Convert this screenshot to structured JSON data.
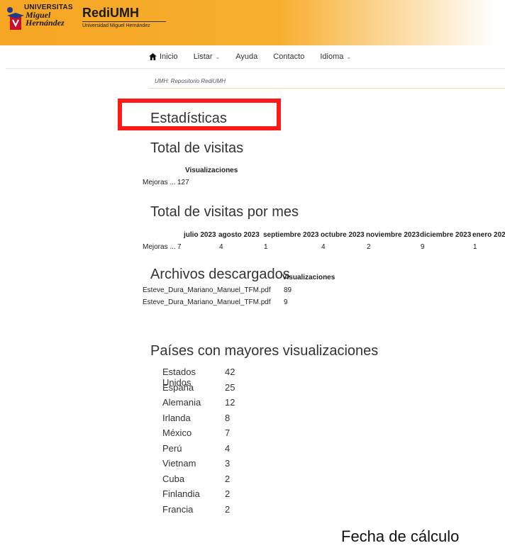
{
  "header": {
    "umh_logo_line1": "UNIVERSITAS",
    "umh_logo_line2": "Miguel Hernández",
    "repo_title": "RediUMH",
    "repo_subtitle": "Universidad Miguel Hernández"
  },
  "nav": {
    "home": "Inicio",
    "listar": "Listar",
    "ayuda": "Ayuda",
    "contacto": "Contacto",
    "idioma": "Idioma",
    "home_icon": "home-icon",
    "caret": "⌄"
  },
  "breadcrumb": "UMH: Repositorio RediUMH",
  "page_title": "Estadísticas",
  "total_visits": {
    "heading": "Total de visitas",
    "column": "Visualizaciones",
    "row_label": "Mejoras ...",
    "row_value": "127"
  },
  "monthly": {
    "heading": "Total de visitas por mes",
    "months": [
      "julio 2023",
      "agosto 2023",
      "septiembre 2023",
      "octubre 2023",
      "noviembre 2023",
      "diciembre 2023",
      "enero 202"
    ],
    "row_label": "Mejoras ...",
    "values": [
      "7",
      "4",
      "1",
      "4",
      "2",
      "9",
      "1"
    ]
  },
  "downloads": {
    "heading": "Archivos descargados",
    "column": "Visualizaciones",
    "rows": [
      {
        "file": "Esteve_Dura_Mariano_Manuel_TFM.pdf",
        "value": "89"
      },
      {
        "file": "Esteve_Dura_Mariano_Manuel_TFM.pdf",
        "value": "9"
      }
    ]
  },
  "countries": {
    "heading": "Países con mayores visualizaciones",
    "rows": [
      {
        "name": "Estados Unidos",
        "value": "42"
      },
      {
        "name": "España",
        "value": "25"
      },
      {
        "name": "Alemania",
        "value": "12"
      },
      {
        "name": "Irlanda",
        "value": "8"
      },
      {
        "name": "México",
        "value": "7"
      },
      {
        "name": "Perú",
        "value": "4"
      },
      {
        "name": "Vietnam",
        "value": "3"
      },
      {
        "name": "Cuba",
        "value": "2"
      },
      {
        "name": "Finlandia",
        "value": "2"
      },
      {
        "name": "Francia",
        "value": "2"
      }
    ]
  },
  "footer_note": "Fecha de cálculo",
  "colors": {
    "header_orange": "#f5a623",
    "highlight_red": "#ff1a1a"
  }
}
